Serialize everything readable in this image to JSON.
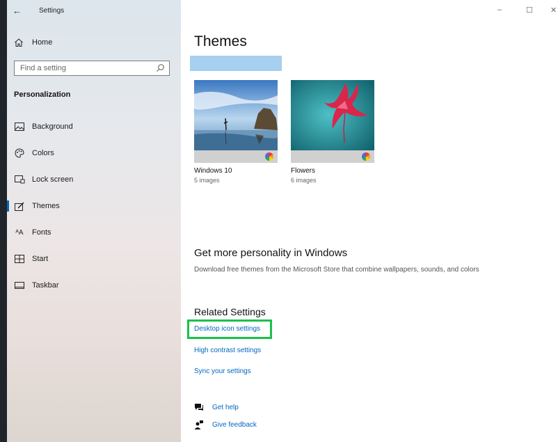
{
  "window": {
    "title": "Settings",
    "controls": {
      "minimize": "–",
      "maximize": "☐",
      "close": "✕"
    }
  },
  "sidebar": {
    "back_glyph": "←",
    "home_label": "Home",
    "search_placeholder": "Find a setting",
    "section_label": "Personalization",
    "items": [
      {
        "label": "Background",
        "icon": "picture-icon"
      },
      {
        "label": "Colors",
        "icon": "palette-icon"
      },
      {
        "label": "Lock screen",
        "icon": "lock-screen-icon"
      },
      {
        "label": "Themes",
        "icon": "themes-icon",
        "active": true
      },
      {
        "label": "Fonts",
        "icon": "fonts-icon"
      },
      {
        "label": "Start",
        "icon": "start-icon"
      },
      {
        "label": "Taskbar",
        "icon": "taskbar-icon"
      }
    ],
    "fonts_glyph": "ᴬA"
  },
  "main": {
    "title": "Themes",
    "themes": [
      {
        "name": "Windows 10",
        "count": "5 images"
      },
      {
        "name": "Flowers",
        "count": "6 images"
      }
    ],
    "personality_heading": "Get more personality in Windows",
    "personality_desc": "Download free themes from the Microsoft Store that combine wallpapers, sounds, and colors",
    "related_heading": "Related Settings",
    "related_links": [
      "Desktop icon settings",
      "High contrast settings",
      "Sync your settings"
    ],
    "help": {
      "get_help": "Get help",
      "give_feedback": "Give feedback"
    }
  },
  "colors": {
    "accent": "#0067c0",
    "highlight": "#19c24a",
    "selection_bar": "#a7cff0"
  }
}
